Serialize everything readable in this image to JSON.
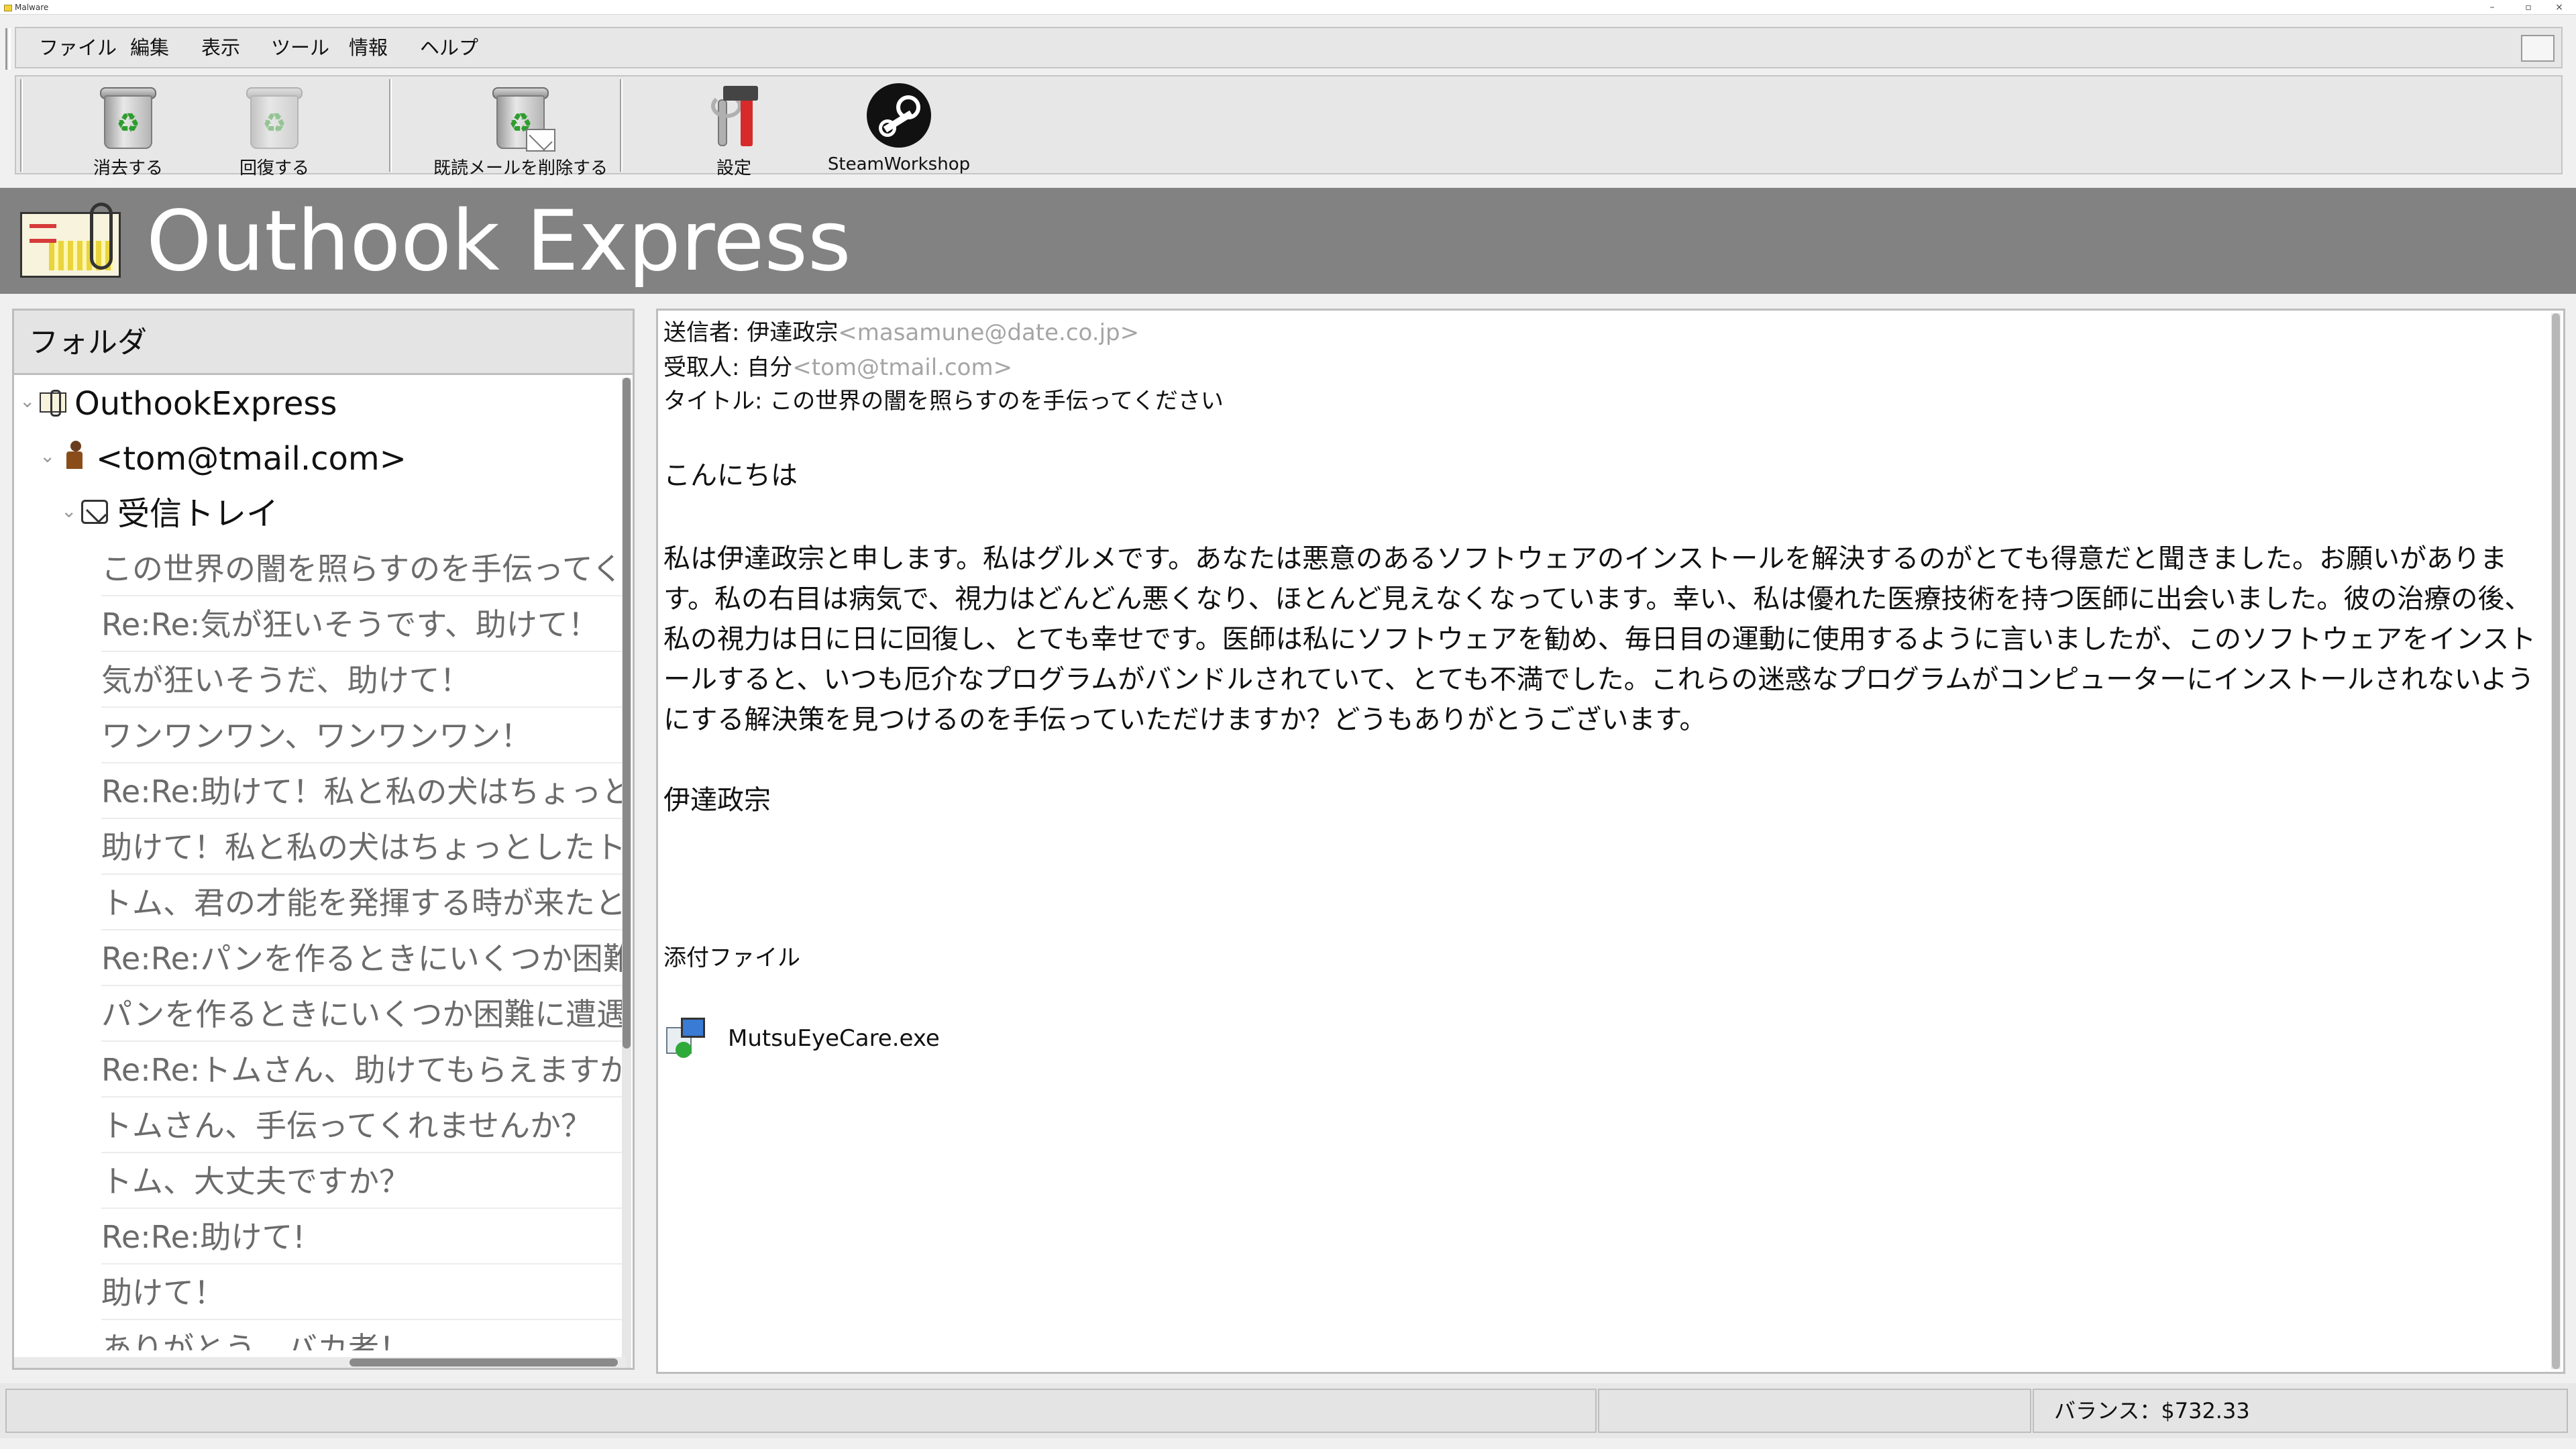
{
  "window": {
    "title": "Malware"
  },
  "menu": [
    "ファイル",
    "編集",
    "表示",
    "ツール",
    "情報",
    "ヘルプ"
  ],
  "toolbar": {
    "delete": "消去する",
    "restore": "回復する",
    "delete_read": "既読メールを削除する",
    "settings": "設定",
    "steam": "SteamWorkshop"
  },
  "banner": {
    "title": "Outhook Express"
  },
  "folders": {
    "header": "フォルダ",
    "root": "OuthookExpress",
    "account": "<tom@tmail.com>",
    "inbox": "受信トレイ",
    "mails": [
      "この世界の闇を照らすのを手伝ってください",
      "Re:Re:気が狂いそうです、助けて！",
      "気が狂いそうだ、助けて！",
      "ワンワンワン、ワンワンワン！",
      "Re:Re:助けて！私と私の犬はちょっとしたトラブルを",
      "助けて！私と私の犬はちょっとしたトラブルを",
      "トム、君の才能を発揮する時が来たと思う",
      "Re:Re:パンを作るときにいくつか困難に遭遇",
      "パンを作るときにいくつか困難に遭遇したの",
      "Re:Re:トムさん、助けてもらえますか？",
      "トムさん、手伝ってくれませんか？",
      "トム、大丈夫ですか？",
      "Re:Re:助けて!",
      "助けて！",
      "ありがとう、バカ者！"
    ]
  },
  "message": {
    "from_label": "送信者: ",
    "from_name": "伊達政宗",
    "from_addr": "<masamune@date.co.jp>",
    "to_label": "受取人: ",
    "to_name": "自分",
    "to_addr": "<tom@tmail.com>",
    "subject_label": "タイトル: ",
    "subject": "この世界の闇を照らすのを手伝ってください",
    "greeting": "こんにちは",
    "body": "私は伊達政宗と申します。私はグルメです。あなたは悪意のあるソフトウェアのインストールを解決するのがとても得意だと聞きました。お願いがあります。私の右目は病気で、視力はどんどん悪くなり、ほとんど見えなくなっています。幸い、私は優れた医療技術を持つ医師に出会いました。彼の治療の後、私の視力は日に日に回復し、とても幸せです。医師は私にソフトウェアを勧め、毎日目の運動に使用するように言いましたが、このソフトウェアをインストールすると、いつも厄介なプログラムがバンドルされていて、とても不満でした。これらの迷惑なプログラムがコンピューターにインストールされないようにする解決策を見つけるのを手伝っていただけますか？どうもありがとうございます。",
    "signature": "伊達政宗",
    "attachments_label": "添付ファイル",
    "attachment_name": "MutsuEyeCare.exe"
  },
  "status": {
    "balance": "バランス：$732.33"
  }
}
